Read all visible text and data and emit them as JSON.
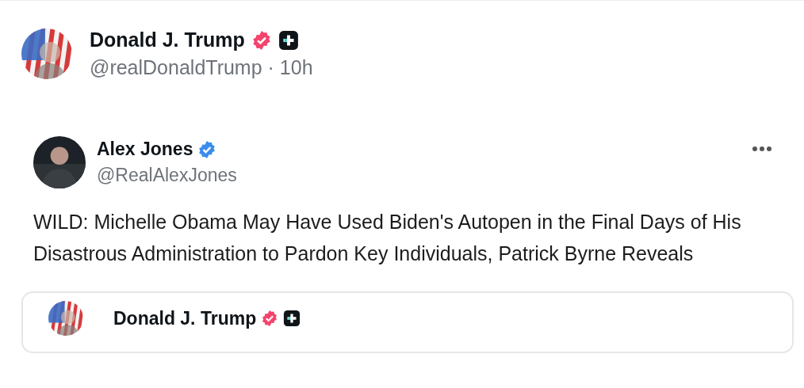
{
  "post": {
    "author": {
      "name": "Donald J. Trump",
      "handle": "@realDonaldTrump",
      "separator": "·",
      "time": "10h",
      "badges": [
        {
          "kind": "verified",
          "color": "#f4436c"
        },
        {
          "kind": "affiliate",
          "color": "#0f1419"
        }
      ]
    },
    "quoted": {
      "author": {
        "name": "Alex Jones",
        "handle": "@RealAlexJones",
        "badges": [
          {
            "kind": "verified",
            "color": "#3b8ced"
          }
        ]
      },
      "text": "WILD: Michelle Obama May Have Used Biden's Autopen in the Final Days of His Disastrous Administration to Pardon Key Individuals, Patrick Byrne Reveals",
      "embedded": {
        "author": {
          "name": "Donald J. Trump",
          "badges": [
            {
              "kind": "verified",
              "color": "#f4436c"
            },
            {
              "kind": "affiliate",
              "color": "#0f1419"
            }
          ]
        }
      }
    }
  }
}
